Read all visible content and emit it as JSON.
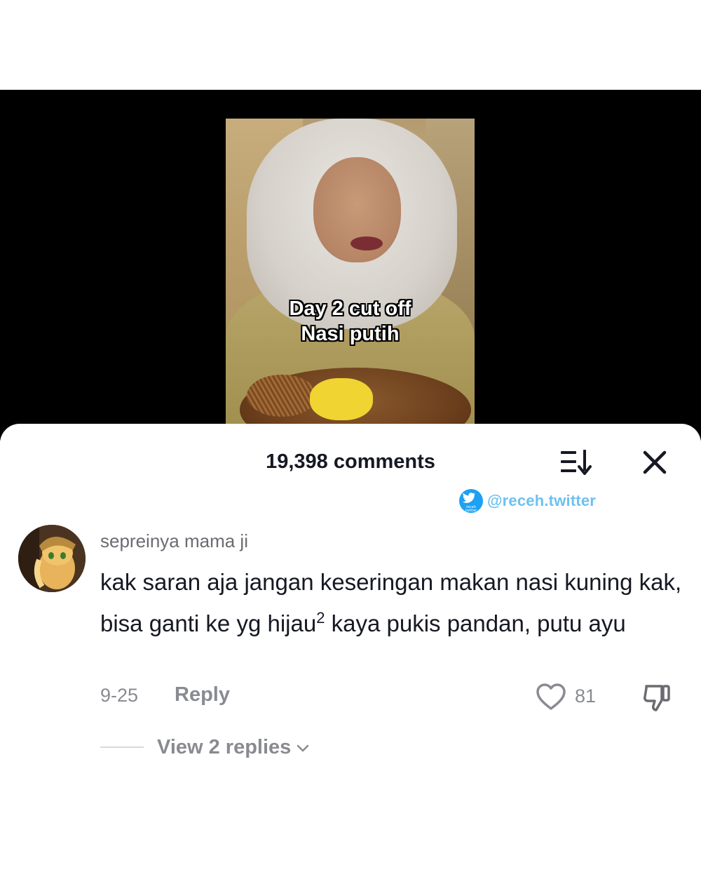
{
  "video": {
    "caption_line1": "Day 2 cut off",
    "caption_line2": "Nasi putih"
  },
  "comments_panel": {
    "count_label": "19,398 comments",
    "sort_icon": "sort-icon",
    "close_icon": "close-icon"
  },
  "watermark": {
    "badge_text_line1": "receh",
    "badge_text_line2": "twitter",
    "handle": "@receh.twitter"
  },
  "comment": {
    "username": "sepreinya mama ji",
    "text_before_sup": "kak saran aja jangan keseringan makan nasi kuning kak, bisa ganti ke yg hijau",
    "text_sup": "2",
    "text_after_sup": " kaya pukis pandan, putu ayu",
    "date": "9-25",
    "reply_label": "Reply",
    "like_count": "81",
    "view_replies_label": "View 2 replies"
  },
  "colors": {
    "accent_watermark": "#6ec1f0",
    "muted_text": "#8a8b91",
    "primary_text": "#161823"
  }
}
